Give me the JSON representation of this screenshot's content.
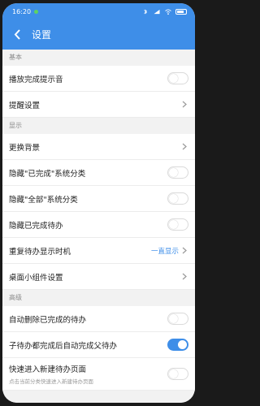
{
  "statusbar": {
    "time": "16:20"
  },
  "appbar": {
    "title": "设置"
  },
  "sections": {
    "basic": "基本",
    "display": "显示",
    "advanced": "高级"
  },
  "rows": {
    "play_sound": {
      "label": "播放完成提示音",
      "on": false
    },
    "reminder": {
      "label": "提醒设置"
    },
    "change_bg": {
      "label": "更换背景"
    },
    "hide_done_cat": {
      "label": "隐藏\"已完成\"系统分类",
      "on": false
    },
    "hide_all_cat": {
      "label": "隐藏\"全部\"系统分类",
      "on": false
    },
    "hide_done_todo": {
      "label": "隐藏已完成待办",
      "on": false
    },
    "repeat_timing": {
      "label": "重复待办显示时机",
      "value": "一直显示"
    },
    "widget": {
      "label": "桌面小组件设置"
    },
    "auto_delete": {
      "label": "自动删除已完成的待办",
      "on": false
    },
    "auto_complete_parent": {
      "label": "子待办都完成后自动完成父待办",
      "on": true
    },
    "quick_new": {
      "label": "快速进入新建待办页面",
      "sub": "点击当前分类快速进入新建待办页面",
      "on": false
    }
  },
  "colors": {
    "accent": "#3e8ee8",
    "background": "#f2f2f2"
  }
}
